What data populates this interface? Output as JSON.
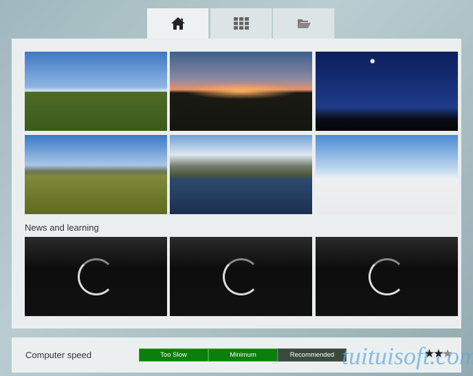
{
  "tabs": [
    {
      "name": "home",
      "icon": "home-icon",
      "active": true
    },
    {
      "name": "grid",
      "icon": "grid-icon"
    },
    {
      "name": "folder",
      "icon": "folder-icon"
    }
  ],
  "environments": [
    "Clear sky day",
    "Sunset",
    "Night sky",
    "Hills grassland",
    "Mountain lake",
    "Blank white"
  ],
  "news": {
    "title": "News and learning",
    "items": 3
  },
  "speed": {
    "label": "Computer speed",
    "levels": [
      "Too Slow",
      "Minimum",
      "Recommended"
    ],
    "stars_filled": 2,
    "stars_total": 3
  },
  "watermark": "tuituisoft.com"
}
